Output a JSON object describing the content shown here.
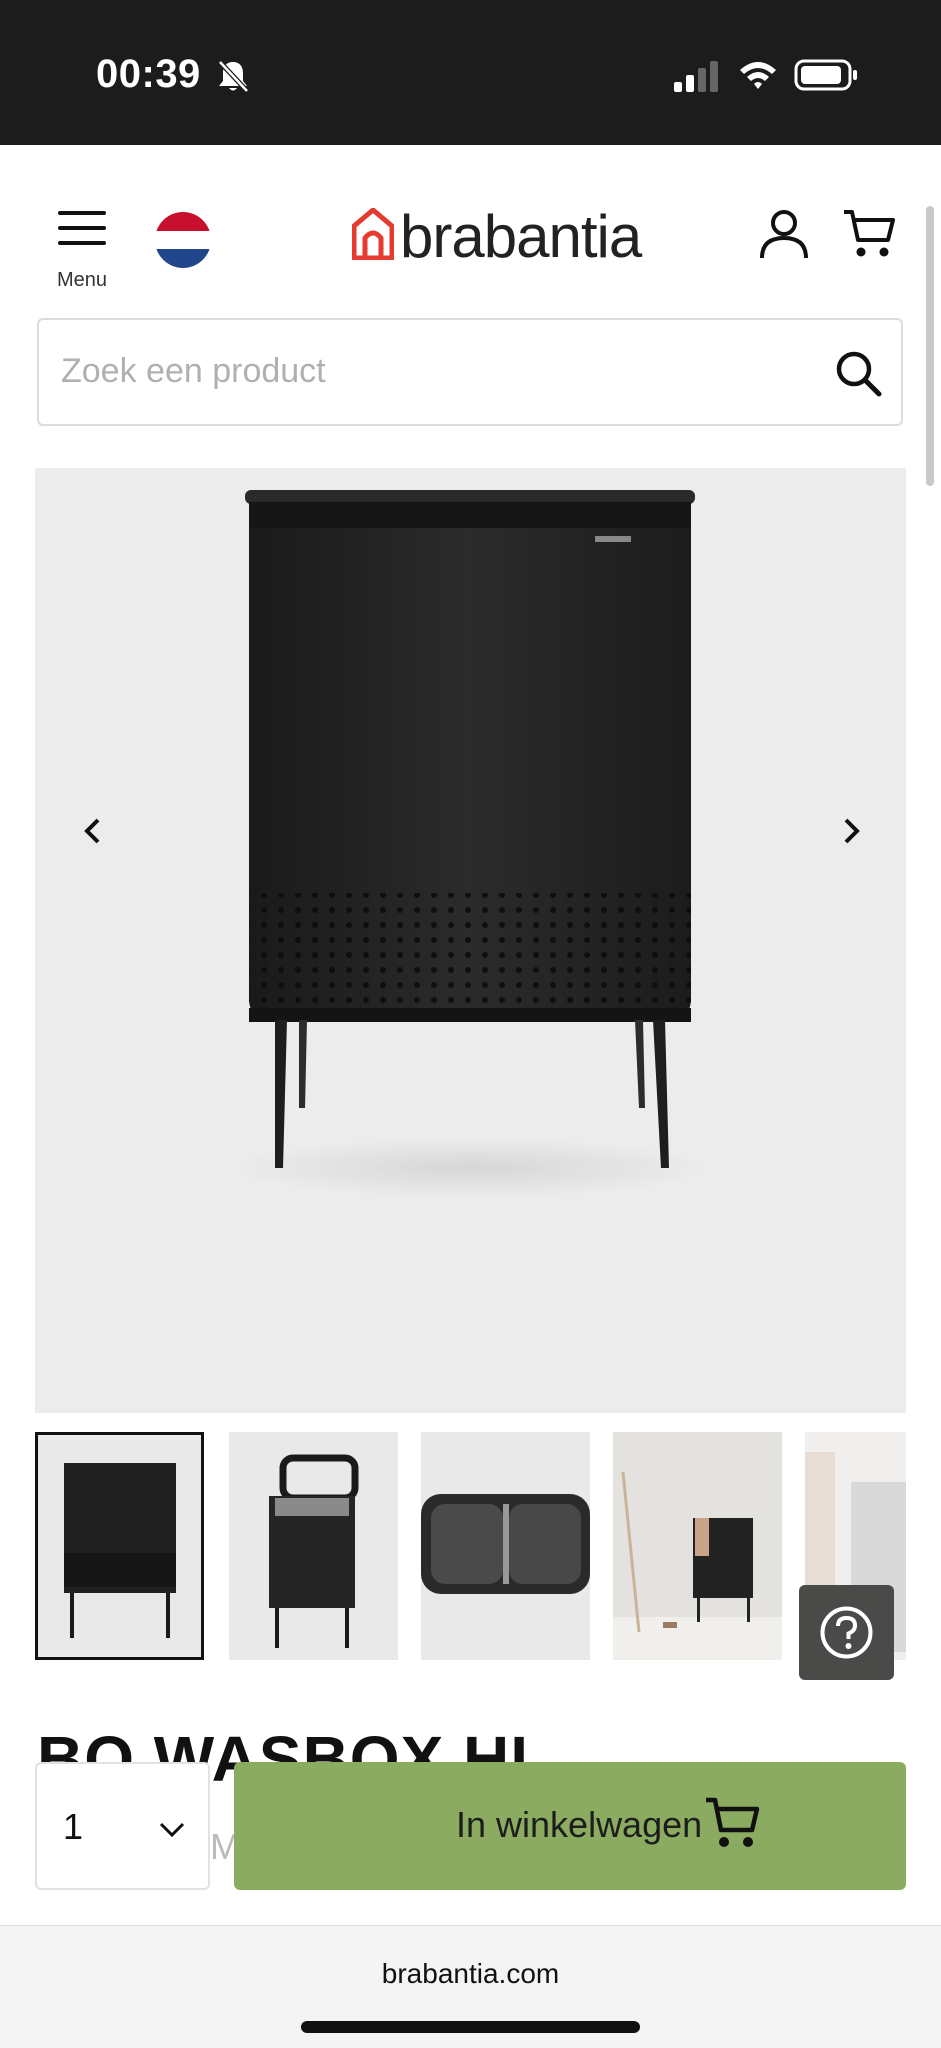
{
  "status_bar": {
    "time": "00:39"
  },
  "header": {
    "menu_label": "Menu",
    "logo_text": "brabantia",
    "colors": {
      "brand_red": "#e53a2f",
      "flag_red": "#c8102e",
      "flag_blue": "#21468b"
    }
  },
  "search": {
    "placeholder": "Zoek een product"
  },
  "gallery": {
    "image_count": 5,
    "active_index": 0
  },
  "product": {
    "title_partial": "BO WASBOX HI",
    "subtitle_partial": "M"
  },
  "actions": {
    "quantity": "1",
    "add_to_cart_label": "In winkelwagen",
    "button_color": "#8bac60"
  },
  "browser": {
    "url": "brabantia.com"
  }
}
